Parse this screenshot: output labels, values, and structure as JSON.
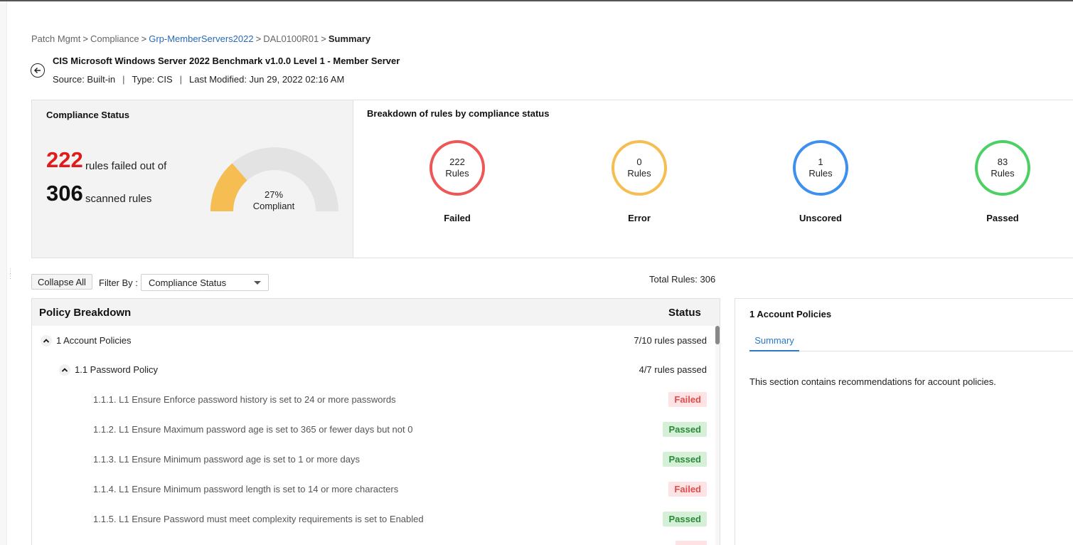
{
  "breadcrumb": {
    "items": [
      "Patch Mgmt",
      "Compliance",
      "Grp-MemberServers2022",
      "DAL0100R01"
    ],
    "current": "Summary",
    "separator": ">"
  },
  "header": {
    "title": "CIS Microsoft Windows Server 2022 Benchmark v1.0.0 Level 1 - Member Server",
    "source": "Source: Built-in",
    "type": "Type: CIS",
    "last_modified": "Last Modified: Jun 29, 2022 02:16 AM",
    "divider": "|",
    "back_icon": "arrow-left-circle-icon"
  },
  "compliance_status": {
    "title": "Compliance Status",
    "failed_count": "222",
    "failed_text": "rules failed out of",
    "scanned_count": "306",
    "scanned_text": "scanned rules",
    "gauge_percent_text": "27%",
    "gauge_label": "Compliant",
    "gauge_fraction": 0.27,
    "gauge_fill_color": "#f5bd52",
    "gauge_track_color": "#e3e3e3"
  },
  "breakdown": {
    "title": "Breakdown of rules by compliance status",
    "unit": "Rules",
    "items": [
      {
        "count": "222",
        "name": "Failed",
        "color": "#ee5757"
      },
      {
        "count": "0",
        "name": "Error",
        "color": "#f6bd52"
      },
      {
        "count": "1",
        "name": "Unscored",
        "color": "#3d8ff0"
      },
      {
        "count": "83",
        "name": "Passed",
        "color": "#4cd064"
      }
    ]
  },
  "toolbar": {
    "collapse_label": "Collapse All",
    "filter_label": "Filter By :",
    "filter_value": "Compliance Status",
    "total_rules": "Total Rules: 306"
  },
  "policy": {
    "header_title": "Policy Breakdown",
    "header_status": "Status",
    "groups": [
      {
        "label": "1 Account Policies",
        "status": "7/10 rules passed"
      },
      {
        "label": "1.1 Password Policy",
        "status": "4/7 rules passed"
      }
    ],
    "rules": [
      {
        "label": "1.1.1. L1 Ensure Enforce password history is set to 24 or more passwords",
        "status": "Failed"
      },
      {
        "label": "1.1.2. L1 Ensure Maximum password age is set to 365 or fewer days but not 0",
        "status": "Passed"
      },
      {
        "label": "1.1.3. L1 Ensure Minimum password age is set to 1 or more days",
        "status": "Passed"
      },
      {
        "label": "1.1.4. L1 Ensure Minimum password length is set to 14 or more characters",
        "status": "Failed"
      },
      {
        "label": "1.1.5. L1 Ensure Password must meet complexity requirements is set to Enabled",
        "status": "Passed"
      }
    ]
  },
  "detail": {
    "title": "1 Account Policies",
    "tab": "Summary",
    "description": "This section contains recommendations for account policies."
  }
}
